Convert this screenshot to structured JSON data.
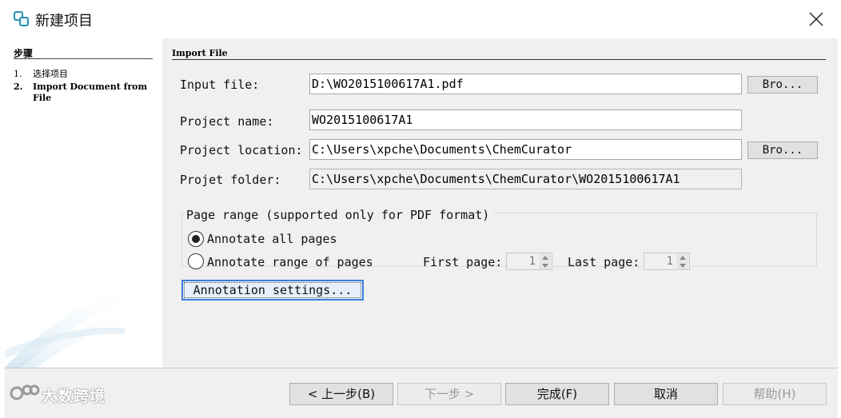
{
  "window": {
    "title": "新建项目",
    "icon": "new-project-icon",
    "close_icon": "close-icon"
  },
  "sidebar": {
    "title": "步骤",
    "steps": [
      {
        "num": "1.",
        "label": "选择项目"
      },
      {
        "num": "2.",
        "label": "Import Document from File"
      }
    ]
  },
  "main": {
    "section_title": "Import File",
    "input_file": {
      "label": "Input file:",
      "value": "D:\\WO2015100617A1.pdf",
      "browse": "Bro..."
    },
    "project_name": {
      "label": "Project name:",
      "value": "WO2015100617A1"
    },
    "project_location": {
      "label": "Project location:",
      "value": "C:\\Users\\xpche\\Documents\\ChemCurator",
      "browse": "Bro..."
    },
    "project_folder": {
      "label": "Projet folder:",
      "value": "C:\\Users\\xpche\\Documents\\ChemCurator\\WO2015100617A1"
    },
    "page_range": {
      "legend": "Page range (supported only for PDF format)",
      "option_all": "Annotate all pages",
      "option_range": "Annotate range of pages",
      "selected": "all",
      "first_label": "First page:",
      "first_value": "1",
      "last_label": "Last page:",
      "last_value": "1"
    },
    "annotation_button": "Annotation settings..."
  },
  "footer": {
    "back": "< 上一步(B)",
    "next": "下一步 >",
    "finish": "完成(F)",
    "cancel": "取消",
    "help": "帮助(H)",
    "watermark": "大数跨境"
  },
  "colors": {
    "panel_bg": "#f0f0f0",
    "focus_border": "#3c7fd6",
    "disabled_text": "#9a9a9a"
  }
}
